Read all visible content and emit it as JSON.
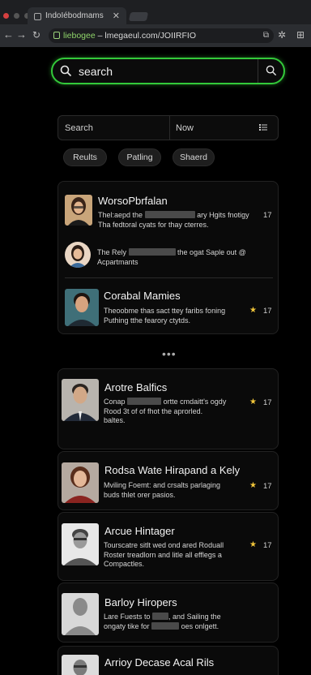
{
  "browser": {
    "tab_title": "IndoIébodmams",
    "url_host": "liebogee",
    "url_rest": " – lmegaeul.com/JOIIRFIO"
  },
  "search": {
    "placeholder": "search",
    "value": ""
  },
  "filter": {
    "left_label": "Search",
    "right_label": "Now"
  },
  "chips": [
    "Reults",
    "Patling",
    "Shaerd"
  ],
  "list1": [
    {
      "name": "WorsoPbrfalan",
      "line1a": "Thel:aepd the",
      "line1b": "ary Hgits fnotigy",
      "line2": "Tha fedtoral cyats for thay cterres.",
      "count": "17",
      "star": false
    },
    {
      "name": "",
      "line1a": "The Rely",
      "line1b": "the ogat Saple out @",
      "line2": "Acpartmants",
      "count": "",
      "star": false
    },
    {
      "name": "Corabal Mamies",
      "line1a": "Theoobme thas sact ttey faribs foning",
      "line1b": "",
      "line2": "Puthing tthe fearory ctytds.",
      "count": "17",
      "star": true
    }
  ],
  "ellipsis": "•••",
  "list2": [
    {
      "name": "Arotre Balfics",
      "line1a": "Conap",
      "line1b": "ortte cmdaitt's ogdy",
      "line2": "Rood 3t of of fhot the aprorled.",
      "line3": "baltes.",
      "count": "17",
      "star": true
    },
    {
      "name": "Rodsa Wate Hirapand a Kely",
      "line1a": "Mviling Foemt: and crsalts parlaging",
      "line1b": "",
      "line2": "buds thlet orer pasios.",
      "line3": "",
      "count": "17",
      "star": true
    },
    {
      "name": "Arcue Hintager",
      "line1a": "Tourscatre sitlt wed ond ared Roduall",
      "line1b": "",
      "line2": "Roster treadlorn and litle all efflegs a",
      "line3": "Compactles.",
      "count": "17",
      "star": true
    },
    {
      "name": "Barloy Hiropers",
      "line1a": "Lare Fuests to",
      "line1b": ", and Sailing the",
      "line2": "ongaty tike for",
      "line2b": "oes onlgett.",
      "line3": "",
      "count": "",
      "star": false
    },
    {
      "name": "Arrioy Decase Acal Rils",
      "line1a": "",
      "line1b": "",
      "line2": "",
      "line3": "",
      "count": "",
      "star": false
    }
  ]
}
